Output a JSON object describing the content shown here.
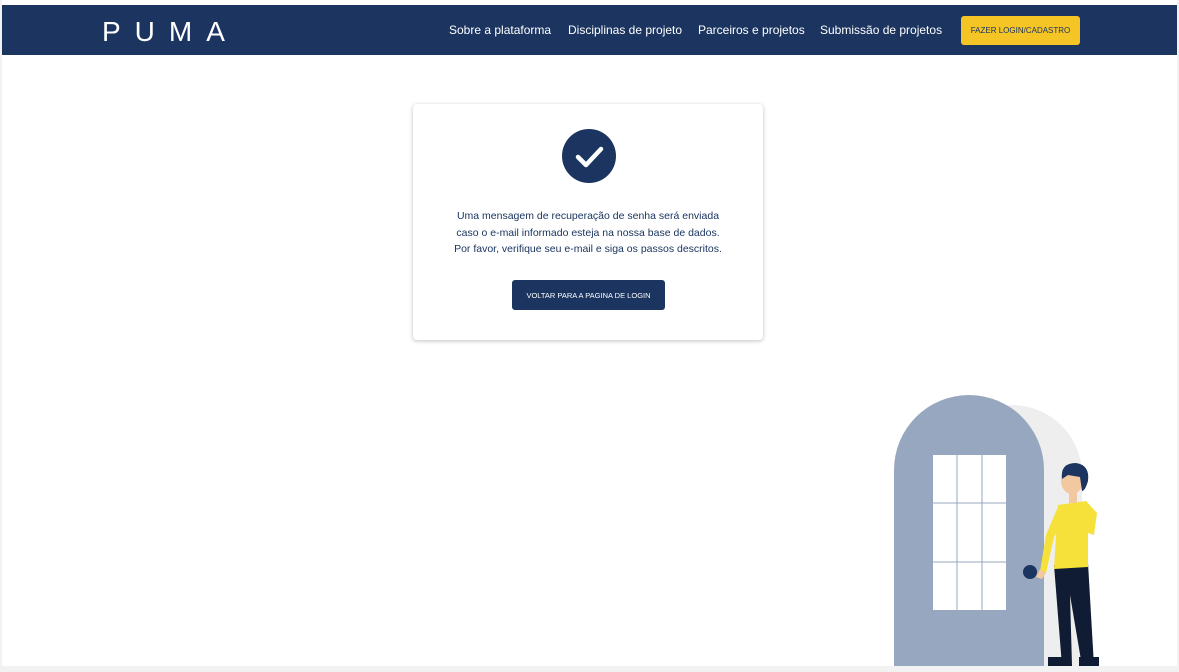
{
  "header": {
    "logo": "PUMA",
    "nav": [
      {
        "label": "Sobre a plataforma"
      },
      {
        "label": "Disciplinas de projeto"
      },
      {
        "label": "Parceiros e projetos"
      },
      {
        "label": "Submissão de projetos"
      }
    ],
    "login_button": "FAZER LOGIN/CADASTRO"
  },
  "card": {
    "icon": "check-circle-icon",
    "message_lines": [
      "Uma mensagem de recuperação de senha será enviada",
      "caso o e-mail informado esteja na nossa base de dados.",
      "Por favor, verifique seu e-mail e siga os passos descritos."
    ],
    "back_button": "VOLTAR PARA A PAGINA DE LOGIN"
  },
  "colors": {
    "primary": "#1b3560",
    "accent": "#f5c526",
    "door": "#97a7bf"
  }
}
